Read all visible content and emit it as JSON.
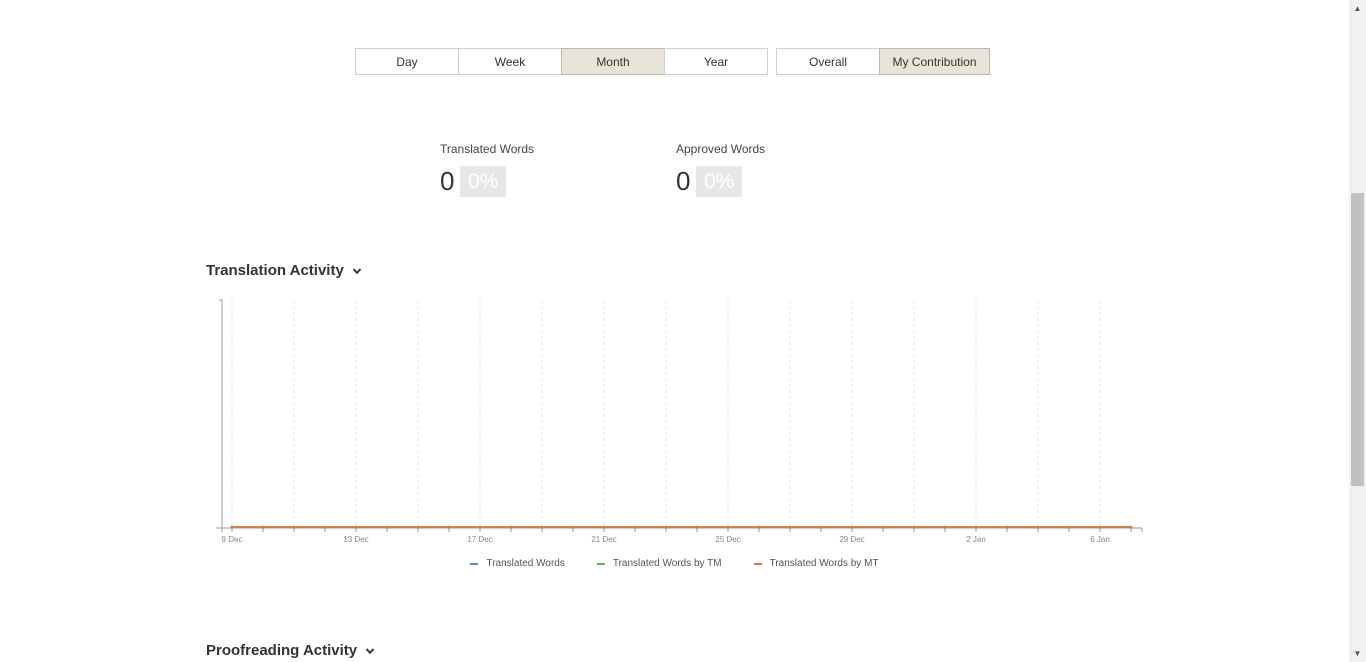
{
  "period_buttons": [
    "Day",
    "Week",
    "Month",
    "Year"
  ],
  "period_active": "Month",
  "scope_buttons": [
    "Overall",
    "My Contribution"
  ],
  "scope_active": "My Contribution",
  "stats": [
    {
      "label": "Translated Words",
      "value": "0",
      "percent": "0%"
    },
    {
      "label": "Approved Words",
      "value": "0",
      "percent": "0%"
    }
  ],
  "translation_activity": {
    "title": "Translation Activity"
  },
  "proofreading_activity": {
    "title": "Proofreading Activity"
  },
  "chart_data": {
    "type": "line",
    "x_tick_labels": [
      "9 Dec",
      "13 Dec",
      "17 Dec",
      "21 Dec",
      "25 Dec",
      "29 Dec",
      "2 Jan",
      "6 Jan"
    ],
    "x": [
      "9 Dec",
      "10 Dec",
      "11 Dec",
      "12 Dec",
      "13 Dec",
      "14 Dec",
      "15 Dec",
      "16 Dec",
      "17 Dec",
      "18 Dec",
      "19 Dec",
      "20 Dec",
      "21 Dec",
      "22 Dec",
      "23 Dec",
      "24 Dec",
      "25 Dec",
      "26 Dec",
      "27 Dec",
      "28 Dec",
      "29 Dec",
      "30 Dec",
      "31 Dec",
      "1 Jan",
      "2 Jan",
      "3 Jan",
      "4 Jan",
      "5 Jan",
      "6 Jan",
      "7 Jan"
    ],
    "series": [
      {
        "name": "Translated Words",
        "color": "#4a90d9",
        "values": [
          0,
          0,
          0,
          0,
          0,
          0,
          0,
          0,
          0,
          0,
          0,
          0,
          0,
          0,
          0,
          0,
          0,
          0,
          0,
          0,
          0,
          0,
          0,
          0,
          0,
          0,
          0,
          0,
          0,
          0
        ]
      },
      {
        "name": "Translated Words by TM",
        "color": "#5cb85c",
        "values": [
          0,
          0,
          0,
          0,
          0,
          0,
          0,
          0,
          0,
          0,
          0,
          0,
          0,
          0,
          0,
          0,
          0,
          0,
          0,
          0,
          0,
          0,
          0,
          0,
          0,
          0,
          0,
          0,
          0,
          0
        ]
      },
      {
        "name": "Translated Words by MT",
        "color": "#e8743b",
        "values": [
          0,
          0,
          0,
          0,
          0,
          0,
          0,
          0,
          0,
          0,
          0,
          0,
          0,
          0,
          0,
          0,
          0,
          0,
          0,
          0,
          0,
          0,
          0,
          0,
          0,
          0,
          0,
          0,
          0,
          0
        ]
      }
    ],
    "grid": true,
    "legend": "bottom"
  }
}
